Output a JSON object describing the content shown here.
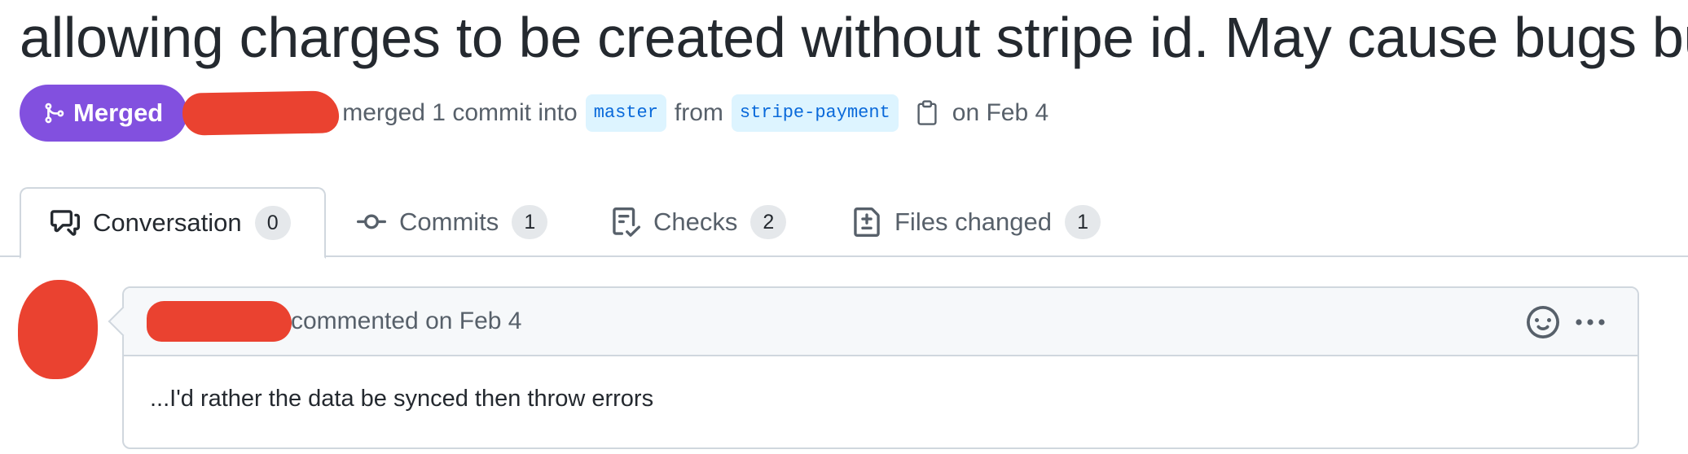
{
  "pr": {
    "title": "allowing charges to be created without stripe id. May cause bugs but",
    "state_label": "Merged",
    "merge_text": "merged 1 commit into",
    "base_branch": "master",
    "from_text": "from",
    "head_branch": "stripe-payment",
    "date_text": "on Feb 4"
  },
  "tabs": [
    {
      "label": "Conversation",
      "count": "0",
      "icon": "conversation-icon",
      "active": true
    },
    {
      "label": "Commits",
      "count": "1",
      "icon": "commit-icon",
      "active": false
    },
    {
      "label": "Checks",
      "count": "2",
      "icon": "checklist-icon",
      "active": false
    },
    {
      "label": "Files changed",
      "count": "1",
      "icon": "file-diff-icon",
      "active": false
    }
  ],
  "comment": {
    "meta": "commented on Feb 4",
    "body": "...I'd rather the data be synced then throw errors"
  },
  "colors": {
    "merged": "#8250df",
    "redaction": "#ea4230",
    "branch_bg": "#ddf4ff",
    "branch_text": "#0969da"
  }
}
